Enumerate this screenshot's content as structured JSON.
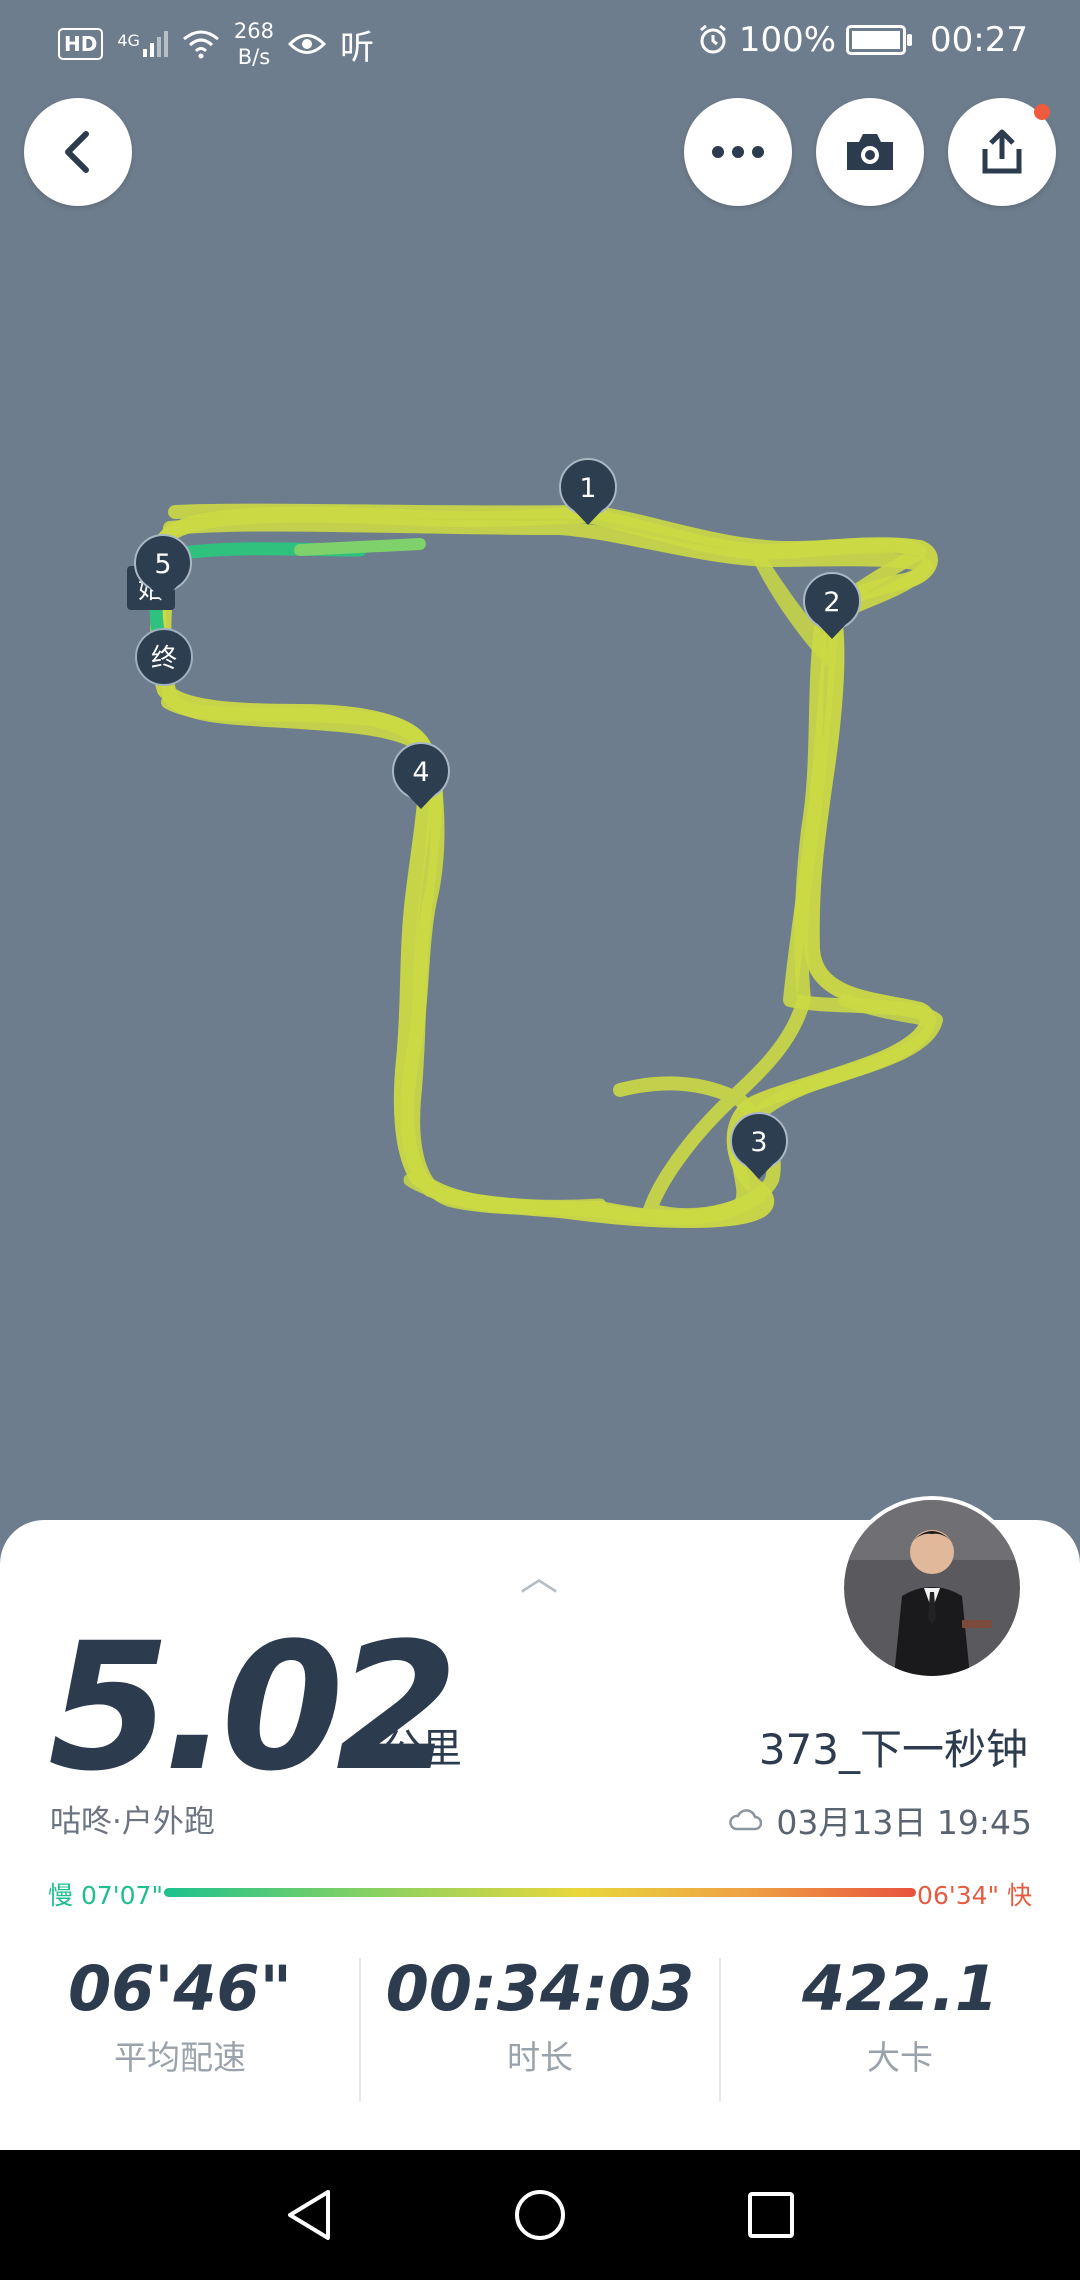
{
  "status_bar": {
    "network": "4G",
    "speed_value": "268",
    "speed_unit": "B/s",
    "listen_label": "听",
    "battery": "100%",
    "time": "00:27"
  },
  "icons": {
    "back": "chevron-left-icon",
    "more": "more-dots-icon",
    "camera": "camera-icon",
    "share": "share-icon"
  },
  "map": {
    "start_label": "始",
    "end_label": "终",
    "km_markers": [
      "1",
      "2",
      "3",
      "4",
      "5"
    ]
  },
  "summary": {
    "distance": "5.02",
    "distance_unit": "公里",
    "username": "373_下一秒钟",
    "sport_type": "咕咚·户外跑",
    "datetime": "03月13日 19:45",
    "weather_icon": "cloud-icon"
  },
  "pace_bar": {
    "slow_label": "慢 07'07\"",
    "fast_label": "06'34\" 快"
  },
  "stats": [
    {
      "value": "06'46\"",
      "label": "平均配速"
    },
    {
      "value": "00:34:03",
      "label": "时长"
    },
    {
      "value": "422.1",
      "label": "大卡"
    }
  ],
  "colors": {
    "map_background": "#6e7d8d",
    "track": "#cbd944",
    "track_start": "#2ec27e",
    "marker": "#2c3e50",
    "text_dark": "#2d3b4e"
  }
}
